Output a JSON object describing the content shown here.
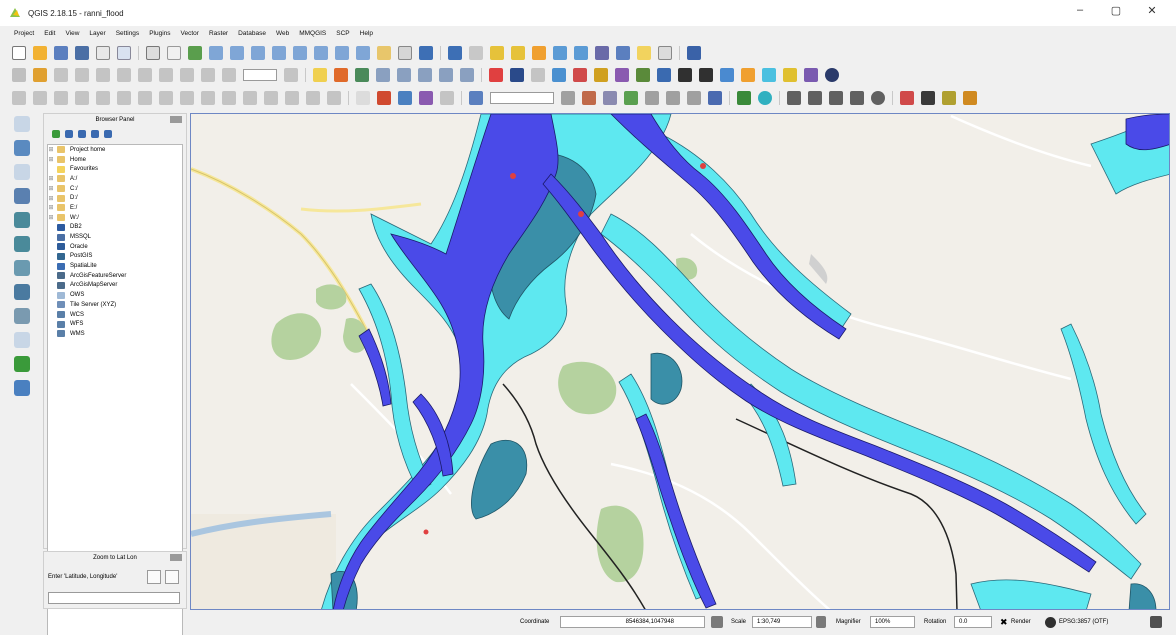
{
  "window": {
    "title": "QGIS 2.18.15 - ranni_flood",
    "minimize": "–",
    "maximize": "▢",
    "close": "✕"
  },
  "menu": [
    "Project",
    "Edit",
    "View",
    "Layer",
    "Settings",
    "Plugins",
    "Vector",
    "Raster",
    "Database",
    "Web",
    "MMQGIS",
    "SCP",
    "Help"
  ],
  "browser_panel": {
    "title": "Browser Panel",
    "items": [
      {
        "label": "Project home",
        "icon": "folder-icon",
        "color": "#e9c46a"
      },
      {
        "label": "Home",
        "icon": "folder-icon",
        "color": "#e9c46a"
      },
      {
        "label": "Favourites",
        "icon": "star-icon",
        "color": "#f4d35e"
      },
      {
        "label": "A:/",
        "icon": "drive-icon",
        "color": "#e9c46a"
      },
      {
        "label": "C:/",
        "icon": "drive-icon",
        "color": "#e9c46a"
      },
      {
        "label": "D:/",
        "icon": "drive-icon",
        "color": "#e9c46a"
      },
      {
        "label": "E:/",
        "icon": "drive-icon",
        "color": "#e9c46a"
      },
      {
        "label": "W:/",
        "icon": "drive-icon",
        "color": "#e9c46a"
      },
      {
        "label": "DB2",
        "icon": "database-icon",
        "color": "#2c5aa0"
      },
      {
        "label": "MSSQL",
        "icon": "database-icon",
        "color": "#4a6fa5"
      },
      {
        "label": "Oracle",
        "icon": "database-icon",
        "color": "#2e5c9a"
      },
      {
        "label": "PostGIS",
        "icon": "elephant-icon",
        "color": "#336791"
      },
      {
        "label": "SpatiaLite",
        "icon": "feather-icon",
        "color": "#3b6db3"
      },
      {
        "label": "ArcGisFeatureServer",
        "icon": "globe-icon",
        "color": "#4b6b8a"
      },
      {
        "label": "ArcGisMapServer",
        "icon": "globe-icon",
        "color": "#4b6b8a"
      },
      {
        "label": "OWS",
        "icon": "globe-icon",
        "color": "#9fb9d6"
      },
      {
        "label": "Tile Server (XYZ)",
        "icon": "globe-icon",
        "color": "#6f8fb8"
      },
      {
        "label": "WCS",
        "icon": "globe-icon",
        "color": "#5a7fa8"
      },
      {
        "label": "WFS",
        "icon": "globe-icon",
        "color": "#5a7fa8"
      },
      {
        "label": "WMS",
        "icon": "globe-icon",
        "color": "#5a7fa8"
      }
    ]
  },
  "zoom_panel": {
    "title": "Zoom to Lat Lon",
    "prompt": "Enter 'Latitude, Longitude'",
    "input_value": ""
  },
  "statusbar": {
    "coordinate_label": "Coordinate",
    "coordinate_value": "8546384,1047948",
    "scale_label": "Scale",
    "scale_value": "1:30,749",
    "magnifier_label": "Magnifier",
    "magnifier_value": "100%",
    "rotation_label": "Rotation",
    "rotation_value": "0.0",
    "render_label": "Render",
    "crs_label": "EPSG:3857 (OTF)"
  },
  "colors": {
    "flood_deep": "#4a4ae8",
    "flood_mid": "#3a8fa8",
    "flood_shallow": "#5ee8f0",
    "basemap": "#f2efe9",
    "park": "#b5d29f",
    "accent": "#6e87c4"
  }
}
